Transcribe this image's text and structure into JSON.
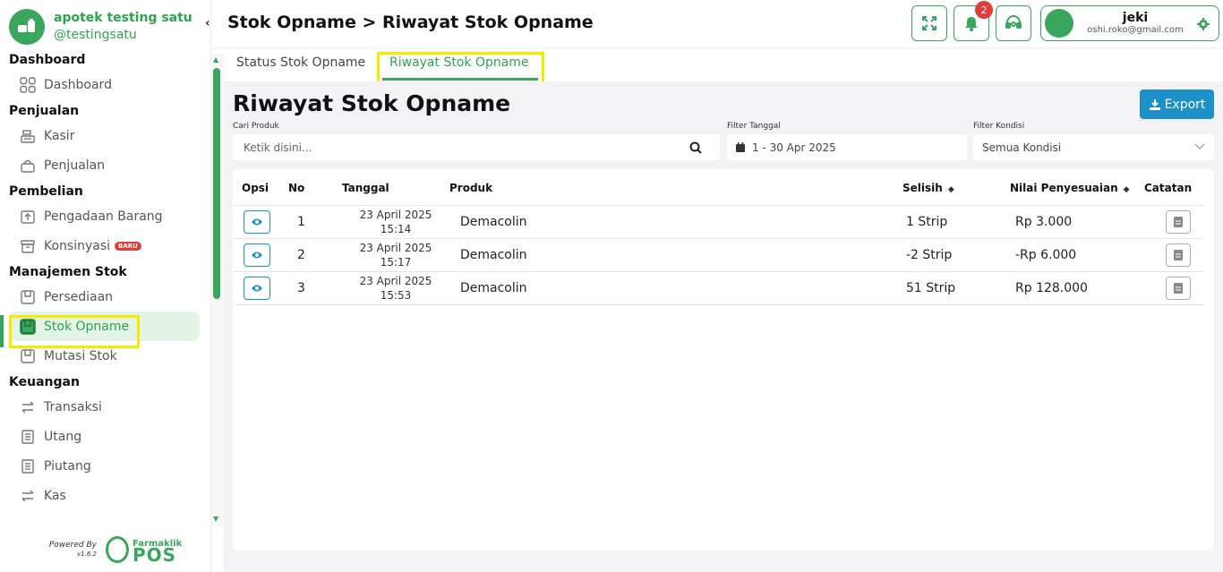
{
  "brand": {
    "name": "apotek testing satu",
    "handle": "@testingsatu"
  },
  "sidebar": {
    "sections": [
      {
        "title": "Dashboard",
        "items": [
          {
            "label": "Dashboard"
          }
        ]
      },
      {
        "title": "Penjualan",
        "items": [
          {
            "label": "Kasir"
          },
          {
            "label": "Penjualan"
          }
        ]
      },
      {
        "title": "Pembelian",
        "items": [
          {
            "label": "Pengadaan Barang"
          },
          {
            "label": "Konsinyasi",
            "badge": "BARU"
          }
        ]
      },
      {
        "title": "Manajemen Stok",
        "items": [
          {
            "label": "Persediaan"
          },
          {
            "label": "Stok Opname"
          },
          {
            "label": "Mutasi Stok"
          }
        ]
      },
      {
        "title": "Keuangan",
        "items": [
          {
            "label": "Transaksi"
          },
          {
            "label": "Utang"
          },
          {
            "label": "Piutang"
          },
          {
            "label": "Kas"
          }
        ]
      }
    ],
    "powered_by": "Powered By",
    "version": "v1.6.2",
    "footer_logo_top": "Farmaklik",
    "footer_logo_bottom": "POS"
  },
  "header": {
    "title": "Stok Opname > Riwayat Stok Opname",
    "notification_count": "2",
    "user_name": "jeki",
    "user_email": "oshi.roko@gmail.com"
  },
  "tabs": [
    {
      "label": "Status Stok Opname"
    },
    {
      "label": "Riwayat Stok Opname"
    }
  ],
  "main": {
    "title": "Riwayat Stok Opname",
    "export_label": "Export",
    "filters": {
      "product_label": "Cari Produk",
      "product_placeholder": "Ketik disini...",
      "date_label": "Filter Tanggal",
      "date_value": "1 - 30 Apr 2025",
      "condition_label": "Filter Kondisi",
      "condition_value": "Semua Kondisi"
    },
    "columns": [
      "Opsi",
      "No",
      "Tanggal",
      "Produk",
      "Selisih",
      "Nilai Penyesuaian",
      "Catatan"
    ],
    "rows": [
      {
        "no": "1",
        "date": "23 April 2025",
        "time": "15:14",
        "product": "Demacolin",
        "diff": "1 Strip",
        "value": "Rp 3.000"
      },
      {
        "no": "2",
        "date": "23 April 2025",
        "time": "15:17",
        "product": "Demacolin",
        "diff": "-2 Strip",
        "value": "-Rp 6.000"
      },
      {
        "no": "3",
        "date": "23 April 2025",
        "time": "15:53",
        "product": "Demacolin",
        "diff": "51 Strip",
        "value": "Rp 128.000"
      }
    ]
  },
  "colors": {
    "primary": "#3aa55d",
    "accent": "#1e90c8",
    "highlight": "#f4ec00",
    "danger": "#e23b3b"
  }
}
